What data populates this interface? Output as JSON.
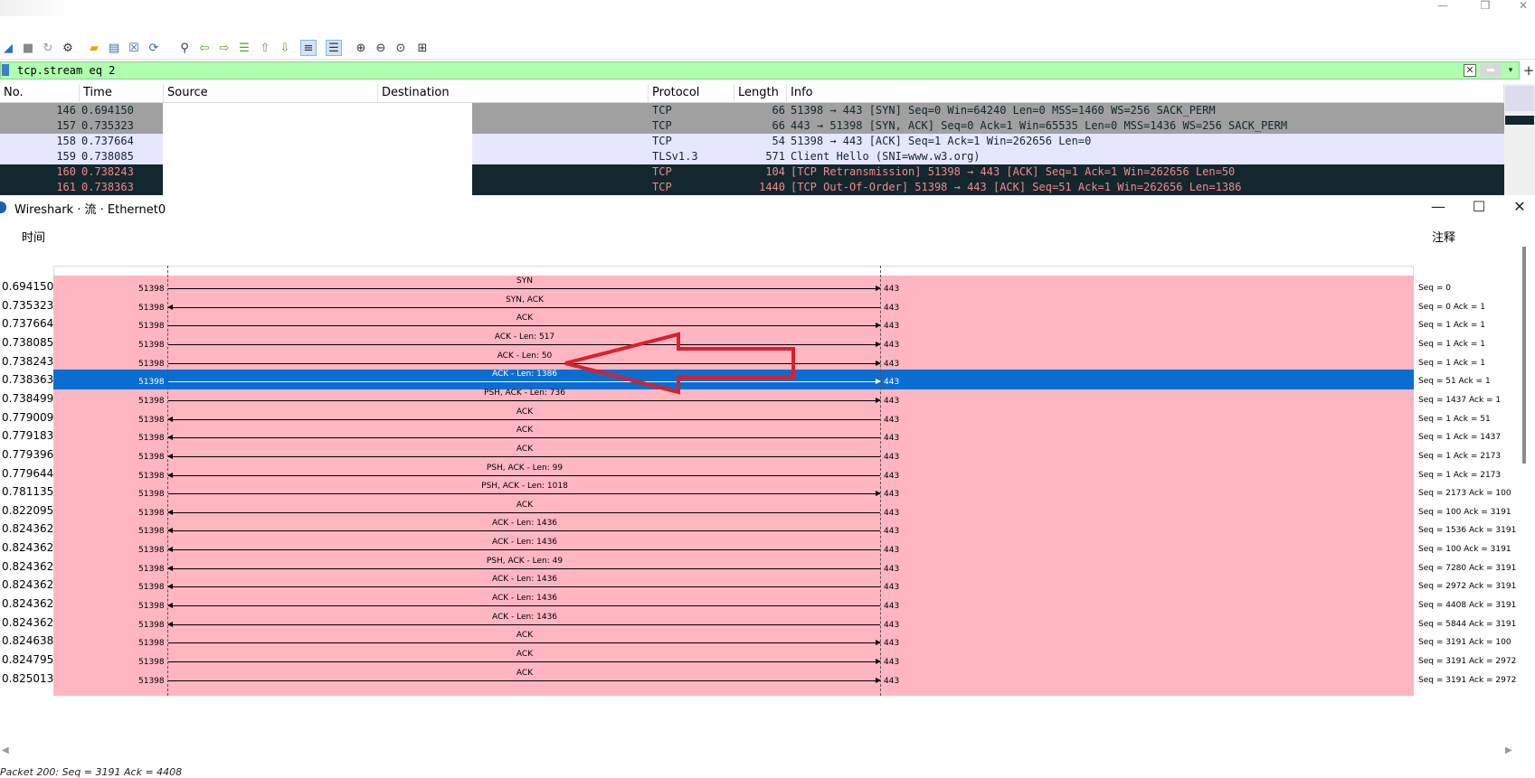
{
  "main_window": {
    "toolbar_icons": [
      "shark-fin-start-icon",
      "stop-square-icon",
      "restart-icon",
      "capture-options-gear-icon",
      "open-folder-icon",
      "save-file-icon",
      "close-file-icon",
      "reload-icon",
      "find-magnifier-icon",
      "go-back-arrow-icon",
      "go-forward-arrow-icon",
      "go-to-packet-icon",
      "go-first-packet-icon",
      "go-last-packet-icon",
      "autoscroll-icon",
      "colorize-icon",
      "zoom-in-icon",
      "zoom-out-icon",
      "zoom-normal-icon",
      "resize-columns-icon"
    ],
    "filter": {
      "value": "tcp.stream eq 2",
      "clear_glyph": "✕",
      "apply_glyph": "➡",
      "dropdown_glyph": "▾",
      "add_glyph": "+"
    },
    "columns": [
      "No.",
      "Time",
      "Source",
      "Destination",
      "Protocol",
      "Length",
      "Info"
    ],
    "packets": [
      {
        "no": "146",
        "time": "0.694150",
        "protocol": "TCP",
        "length": "66",
        "info": "51398 → 443 [SYN] Seq=0 Win=64240 Len=0 MSS=1460 WS=256 SACK_PERM",
        "style": "gray"
      },
      {
        "no": "157",
        "time": "0.735323",
        "protocol": "TCP",
        "length": "66",
        "info": "443 → 51398 [SYN, ACK] Seq=0 Ack=1 Win=65535 Len=0 MSS=1436 WS=256 SACK_PERM",
        "style": "gray"
      },
      {
        "no": "158",
        "time": "0.737664",
        "protocol": "TCP",
        "length": "54",
        "info": "51398 → 443 [ACK] Seq=1 Ack=1 Win=262656 Len=0",
        "style": "lav"
      },
      {
        "no": "159",
        "time": "0.738085",
        "protocol": "TLSv1.3",
        "length": "571",
        "info": "Client Hello (SNI=www.w3.org)",
        "style": "lav"
      },
      {
        "no": "160",
        "time": "0.738243",
        "protocol": "TCP",
        "length": "104",
        "info": "[TCP Retransmission] 51398 → 443 [ACK] Seq=1 Ack=1 Win=262656 Len=50",
        "style": "dark"
      },
      {
        "no": "161",
        "time": "0.738363",
        "protocol": "TCP",
        "length": "1440",
        "info": "[TCP Out-Of-Order] 51398 → 443 [ACK] Seq=51 Ack=1 Win=262656 Len=1386",
        "style": "dark"
      }
    ]
  },
  "flow_window": {
    "title": "Wireshark · 流 · Ethernet0",
    "controls": {
      "minimize": "—",
      "maximize": "☐",
      "close": "✕"
    },
    "time_header": "时间",
    "comment_header": "注释",
    "colors": {
      "flow_bg": "#ffb6c1",
      "selected": "#0a6ed1",
      "arrow_annotation": "#d9202c"
    },
    "rows": [
      {
        "time": "0.694150",
        "port_a": "51398",
        "label": "SYN",
        "dir": "r",
        "port_b": "443",
        "comment": "Seq = 0"
      },
      {
        "time": "0.735323",
        "port_a": "51398",
        "label": "SYN, ACK",
        "dir": "l",
        "port_b": "443",
        "comment": "Seq = 0 Ack = 1"
      },
      {
        "time": "0.737664",
        "port_a": "51398",
        "label": "ACK",
        "dir": "r",
        "port_b": "443",
        "comment": "Seq = 1 Ack = 1"
      },
      {
        "time": "0.738085",
        "port_a": "51398",
        "label": "ACK - Len: 517",
        "dir": "r",
        "port_b": "443",
        "comment": "Seq = 1 Ack = 1"
      },
      {
        "time": "0.738243",
        "port_a": "51398",
        "label": "ACK - Len: 50",
        "dir": "r",
        "port_b": "443",
        "comment": "Seq = 1 Ack = 1"
      },
      {
        "time": "0.738363",
        "port_a": "51398",
        "label": "ACK - Len: 1386",
        "dir": "r",
        "port_b": "443",
        "comment": "Seq = 51 Ack = 1",
        "selected": true
      },
      {
        "time": "0.738499",
        "port_a": "51398",
        "label": "PSH, ACK - Len: 736",
        "dir": "r",
        "port_b": "443",
        "comment": "Seq = 1437 Ack = 1"
      },
      {
        "time": "0.779009",
        "port_a": "51398",
        "label": "ACK",
        "dir": "l",
        "port_b": "443",
        "comment": "Seq = 1 Ack = 51"
      },
      {
        "time": "0.779183",
        "port_a": "51398",
        "label": "ACK",
        "dir": "l",
        "port_b": "443",
        "comment": "Seq = 1 Ack = 1437"
      },
      {
        "time": "0.779396",
        "port_a": "51398",
        "label": "ACK",
        "dir": "l",
        "port_b": "443",
        "comment": "Seq = 1 Ack = 2173"
      },
      {
        "time": "0.779644",
        "port_a": "51398",
        "label": "PSH, ACK - Len: 99",
        "dir": "l",
        "port_b": "443",
        "comment": "Seq = 1 Ack = 2173"
      },
      {
        "time": "0.781135",
        "port_a": "51398",
        "label": "PSH, ACK - Len: 1018",
        "dir": "r",
        "port_b": "443",
        "comment": "Seq = 2173 Ack = 100"
      },
      {
        "time": "0.822095",
        "port_a": "51398",
        "label": "ACK",
        "dir": "l",
        "port_b": "443",
        "comment": "Seq = 100 Ack = 3191"
      },
      {
        "time": "0.824362",
        "port_a": "51398",
        "label": "ACK - Len: 1436",
        "dir": "l",
        "port_b": "443",
        "comment": "Seq = 1536 Ack = 3191"
      },
      {
        "time": "0.824362",
        "port_a": "51398",
        "label": "ACK - Len: 1436",
        "dir": "l",
        "port_b": "443",
        "comment": "Seq = 100 Ack = 3191"
      },
      {
        "time": "0.824362",
        "port_a": "51398",
        "label": "PSH, ACK - Len: 49",
        "dir": "l",
        "port_b": "443",
        "comment": "Seq = 7280 Ack = 3191"
      },
      {
        "time": "0.824362",
        "port_a": "51398",
        "label": "ACK - Len: 1436",
        "dir": "l",
        "port_b": "443",
        "comment": "Seq = 2972 Ack = 3191"
      },
      {
        "time": "0.824362",
        "port_a": "51398",
        "label": "ACK - Len: 1436",
        "dir": "l",
        "port_b": "443",
        "comment": "Seq = 4408 Ack = 3191"
      },
      {
        "time": "0.824362",
        "port_a": "51398",
        "label": "ACK - Len: 1436",
        "dir": "l",
        "port_b": "443",
        "comment": "Seq = 5844 Ack = 3191"
      },
      {
        "time": "0.824638",
        "port_a": "51398",
        "label": "ACK",
        "dir": "r",
        "port_b": "443",
        "comment": "Seq = 3191 Ack = 100"
      },
      {
        "time": "0.824795",
        "port_a": "51398",
        "label": "ACK",
        "dir": "r",
        "port_b": "443",
        "comment": "Seq = 3191 Ack = 2972"
      },
      {
        "time": "0.825013",
        "port_a": "51398",
        "label": "ACK",
        "dir": "r",
        "port_b": "443",
        "comment": "Seq = 3191 Ack = 2972"
      }
    ],
    "status": "Packet 200: Seq = 3191 Ack = 4408",
    "scroll_left": "◀",
    "scroll_right": "▶"
  }
}
